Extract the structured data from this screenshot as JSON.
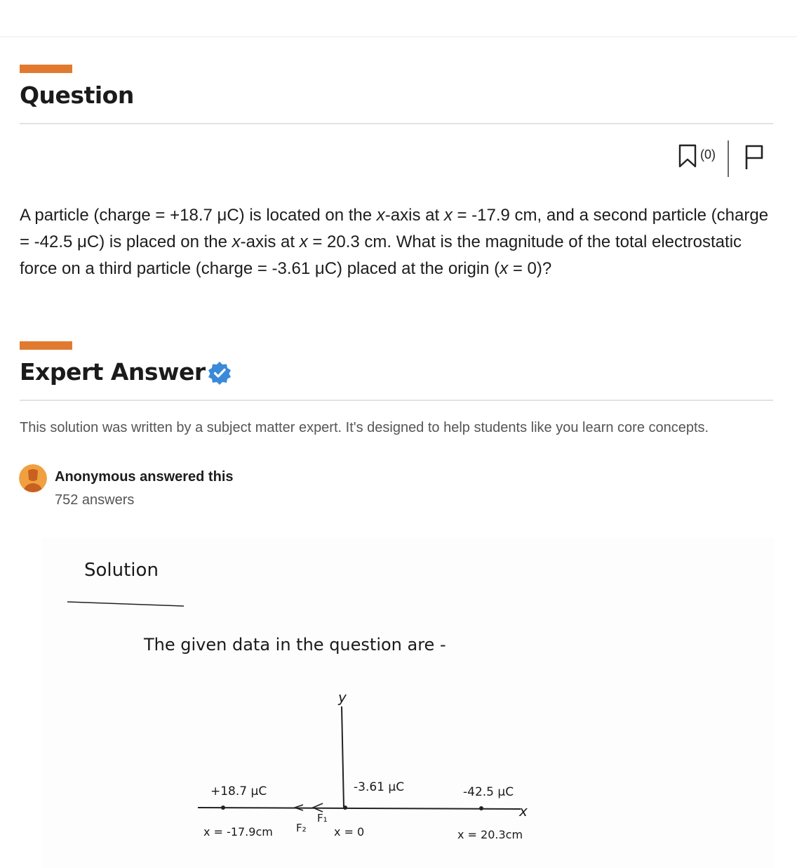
{
  "question": {
    "title": "Question",
    "bookmark_count": "(0)",
    "text_parts": [
      "A particle (charge = +18.7 μC) is located on the ",
      "x",
      "-axis at ",
      "x",
      " = -17.9 cm, and a second particle (charge = -42.5 μC) is placed on the ",
      "x",
      "-axis at ",
      "x",
      " = 20.3 cm. What is the magnitude of the total electrostatic force on a third particle (charge = -3.61 μC) placed at the origin (",
      "x",
      " = 0)?"
    ]
  },
  "answer": {
    "title": "Expert Answer",
    "note": "This solution was written by a subject matter expert. It's designed to help students like you learn core concepts.",
    "author": "Anonymous answered this",
    "answers_count": "752 answers"
  },
  "solution": {
    "heading": "Solution",
    "intro": "The given data in the question are -",
    "y_axis_label": "y",
    "x_axis_label": "x",
    "charge_left": "+18.7 μC",
    "charge_middle": "-3.61 μC",
    "charge_right": "-42.5 μC",
    "pos_left": "x = -17.9cm",
    "pos_middle": "x = 0",
    "pos_right": "x = 20.3cm",
    "force_f2": "F₂",
    "force_f1": "F₁"
  },
  "colors": {
    "accent": "#e17a2f",
    "verified": "#3b8ad9",
    "avatar": "#f0a040"
  }
}
